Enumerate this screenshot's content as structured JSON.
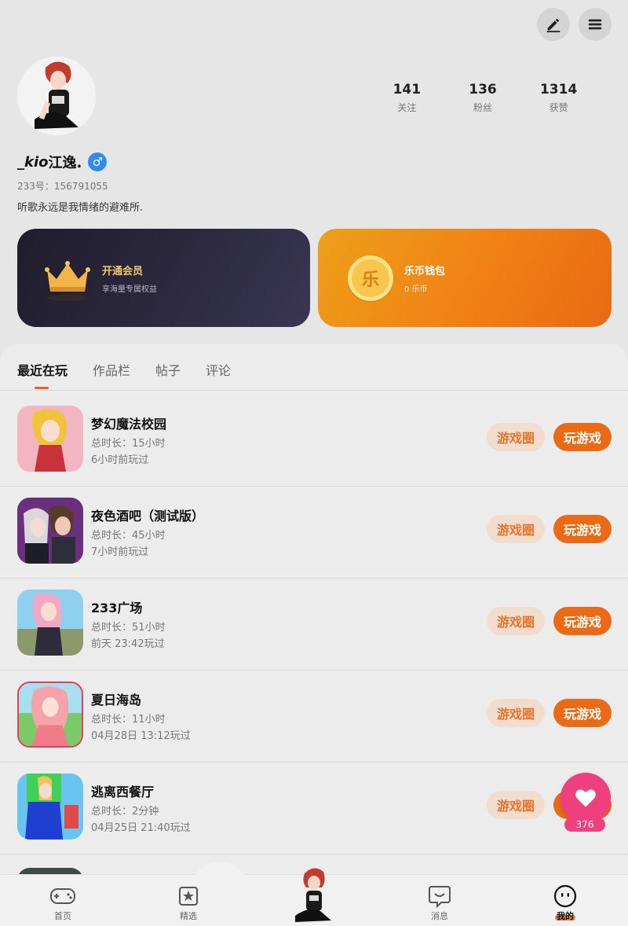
{
  "header": {
    "edit_icon": "pencil-icon",
    "menu_icon": "menu-icon"
  },
  "profile": {
    "username_prefix": "_kio",
    "username_suffix": "江逸.",
    "gender_symbol": "♂",
    "uid": "233号：156791055",
    "bio": "听歌永远是我情绪的避难所.",
    "stats": [
      {
        "value": "141",
        "label": "关注"
      },
      {
        "value": "136",
        "label": "粉丝"
      },
      {
        "value": "1314",
        "label": "获赞"
      }
    ]
  },
  "cards": {
    "vip": {
      "title": "开通会员",
      "subtitle": "享海量专属权益"
    },
    "wallet": {
      "title": "乐币钱包",
      "subtitle": "0 乐币",
      "coin_glyph": "乐"
    }
  },
  "tabs": [
    "最近在玩",
    "作品栏",
    "帖子",
    "评论"
  ],
  "games": [
    {
      "name": "梦幻魔法校园",
      "duration": "总时长：15小时",
      "last_played": "6小时前玩过",
      "circle_label": "游戏圈",
      "play_label": "玩游戏"
    },
    {
      "name": "夜色酒吧（测试版）",
      "duration": "总时长：45小时",
      "last_played": "7小时前玩过",
      "circle_label": "游戏圈",
      "play_label": "玩游戏"
    },
    {
      "name": "233广场",
      "duration": "总时长：51小时",
      "last_played": "前天 23:42玩过",
      "circle_label": "游戏圈",
      "play_label": "玩游戏"
    },
    {
      "name": "夏日海岛",
      "duration": "总时长：11小时",
      "last_played": "04月28日 13:12玩过",
      "circle_label": "游戏圈",
      "play_label": "玩游戏"
    },
    {
      "name": "逃离西餐厅",
      "duration": "总时长：2分钟",
      "last_played": "04月25日 21:40玩过",
      "circle_label": "游戏圈",
      "play_label": "玩游戏"
    }
  ],
  "fab": {
    "count": "376"
  },
  "nav": {
    "home": "首页",
    "featured": "精选",
    "messages": "消息",
    "mine": "我的"
  },
  "colors": {
    "accent": "#ea6a16",
    "fab": "#ee3f7f",
    "gender": "#2e8bf0"
  }
}
